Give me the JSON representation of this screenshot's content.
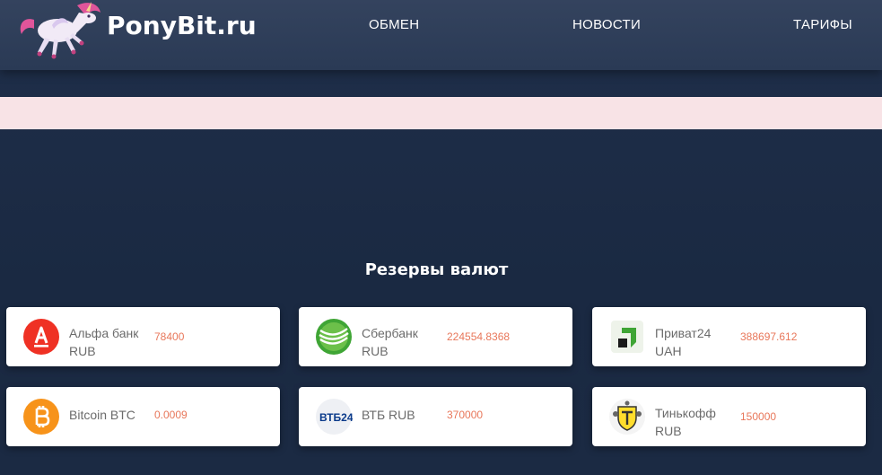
{
  "header": {
    "brand": "PonyBit.ru",
    "nav": [
      {
        "label": "ОБМЕН"
      },
      {
        "label": "НОВОСТИ"
      },
      {
        "label": "ТАРИФЫ"
      }
    ]
  },
  "reserves": {
    "title": "Резервы валют",
    "items": [
      {
        "name": "Альфа банк",
        "currency": "RUB",
        "amount": "78400",
        "icon": "alfa-bank-icon"
      },
      {
        "name": "Сбербанк",
        "currency": "RUB",
        "amount": "224554.8368",
        "icon": "sberbank-icon"
      },
      {
        "name": "Приват24",
        "currency": "UAH",
        "amount": "388697.612",
        "icon": "privat24-icon"
      },
      {
        "name": "Bitcoin BTC",
        "currency": "",
        "amount": "0.0009",
        "icon": "bitcoin-icon"
      },
      {
        "name": "ВТБ RUB",
        "currency": "",
        "amount": "370000",
        "icon": "vtb24-icon"
      },
      {
        "name": "Тинькофф",
        "currency": "RUB",
        "amount": "150000",
        "icon": "tinkoff-icon"
      }
    ],
    "vtb_logo_text": "ВТБ24"
  },
  "colors": {
    "header_bg": "#2f3f5a",
    "page_bg": "#1c2b45",
    "strip": "#f8e3e6",
    "amount": "#e8775a",
    "alfa_red": "#ef3124",
    "bitcoin": "#f7931a",
    "vtb_blue": "#0a3a8a",
    "vtb_red": "#e4202a"
  }
}
